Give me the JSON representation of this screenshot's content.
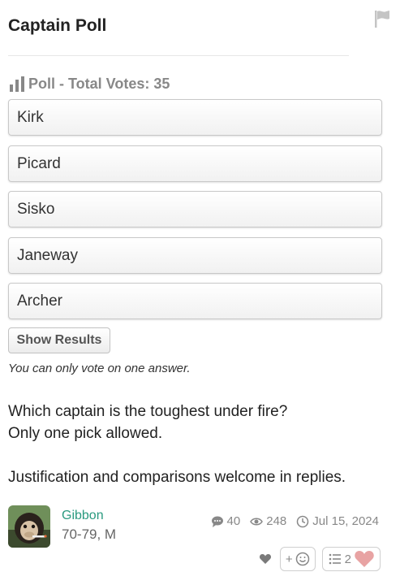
{
  "post": {
    "title": "Captain Poll"
  },
  "poll": {
    "header": "Poll - Total Votes: 35",
    "options": [
      "Kirk",
      "Picard",
      "Sisko",
      "Janeway",
      "Archer"
    ],
    "show_results_label": "Show Results",
    "note": "You can only vote on one answer."
  },
  "body": {
    "line1": "Which captain is the toughest under fire?",
    "line2": "Only one pick allowed.",
    "line3": "Justification and comparisons welcome in replies."
  },
  "author": {
    "name": "Gibbon",
    "meta": "70-79, M"
  },
  "stats": {
    "comments": "40",
    "views": "248",
    "date": "Jul 15, 2024"
  },
  "actions": {
    "add_reaction_label": "+",
    "reaction_count": "2"
  },
  "colors": {
    "author_link": "#2a9a7f",
    "reaction_heart": "#e8a3a3"
  }
}
